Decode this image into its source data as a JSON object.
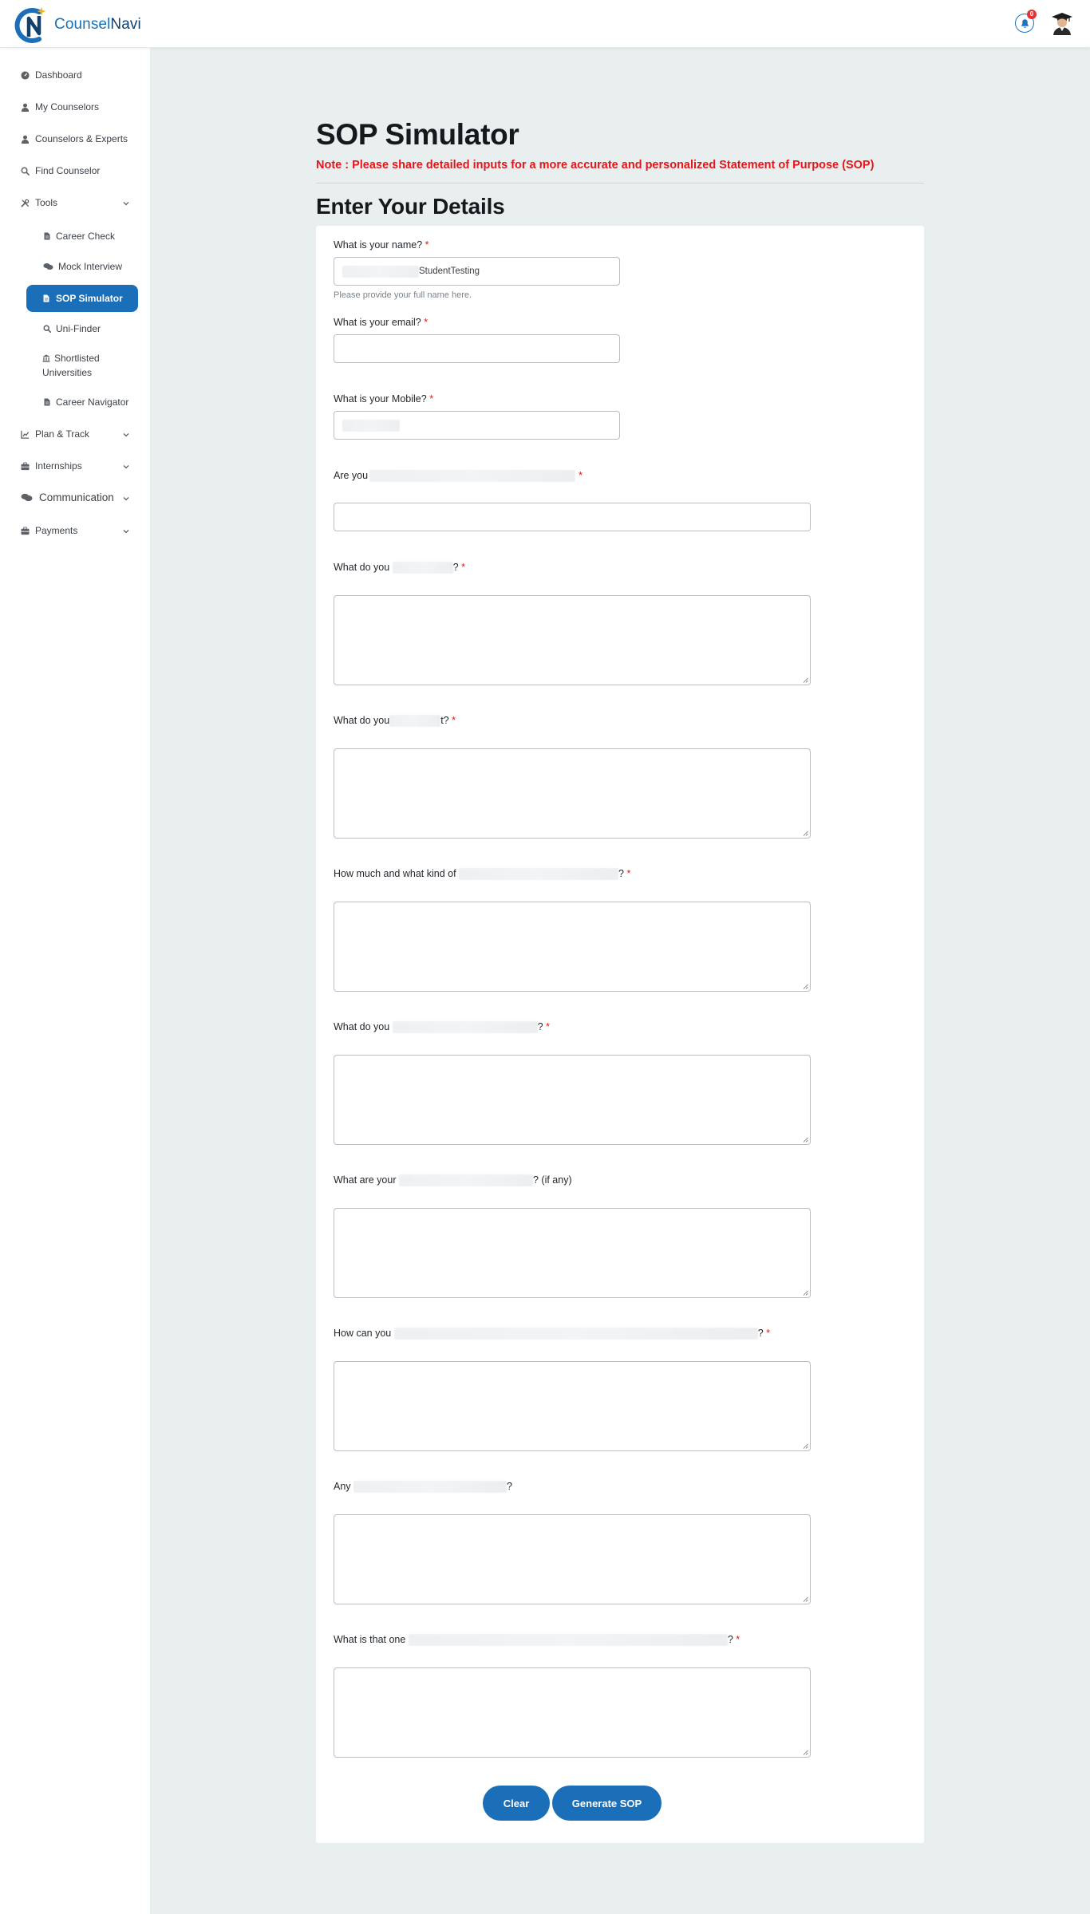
{
  "app": {
    "logo_part1": "Counsel",
    "logo_part2": "Navi",
    "notification_count": "0"
  },
  "sidebar": {
    "items": [
      {
        "label": "Dashboard",
        "icon": "dashboard-icon"
      },
      {
        "label": "My Counselors",
        "icon": "user-icon"
      },
      {
        "label": "Counselors & Experts",
        "icon": "user-icon"
      },
      {
        "label": "Find Counselor",
        "icon": "search-icon"
      },
      {
        "label": "Tools",
        "icon": "tools-icon"
      },
      {
        "label": "Plan & Track",
        "icon": "chart-icon"
      },
      {
        "label": "Internships",
        "icon": "briefcase-icon"
      },
      {
        "label": "Communication",
        "icon": "comments-icon"
      },
      {
        "label": "Payments",
        "icon": "briefcase-icon"
      }
    ],
    "tools_sub": [
      {
        "label": "Career Check",
        "icon": "document-icon"
      },
      {
        "label": "Mock Interview",
        "icon": "comments-icon"
      },
      {
        "label": "SOP Simulator",
        "icon": "document-icon",
        "active": true
      },
      {
        "label": "Uni-Finder",
        "icon": "search-icon"
      },
      {
        "label": "Shortlisted Universities",
        "icon": "university-icon"
      },
      {
        "label": "Career Navigator",
        "icon": "document-icon"
      }
    ]
  },
  "main": {
    "title": "SOP Simulator",
    "note": "Note : Please share detailed inputs for a more accurate and personalized Statement of Purpose (SOP)",
    "section_title": "Enter Your Details"
  },
  "form": {
    "name_label": "What is your name?",
    "name_value": "StudentTesting",
    "name_help": "Please provide your full name here.",
    "email_label": "What is your email?",
    "mobile_label": "What is your Mobile?",
    "q1_prefix": "Are you",
    "q2_prefix": "What do you",
    "q2_suffix": "?",
    "q3_prefix": "What do you",
    "q3_suffix": "t?",
    "q4_prefix": "How much and what kind of",
    "q4_suffix": "?",
    "q5_prefix": "What do you",
    "q5_suffix": "?",
    "q6_prefix": "What are your",
    "q6_suffix": "? (if any)",
    "q7_prefix": "How can you",
    "q7_suffix": "?",
    "q8_prefix": "Any",
    "q8_suffix": "?",
    "q9_prefix": "What is that one",
    "q9_suffix": "?",
    "required_mark": "*",
    "clear_label": "Clear",
    "generate_label": "Generate SOP"
  },
  "colors": {
    "accent": "#1a6fb8",
    "required": "#e3161b",
    "background": "#e9eeee"
  }
}
